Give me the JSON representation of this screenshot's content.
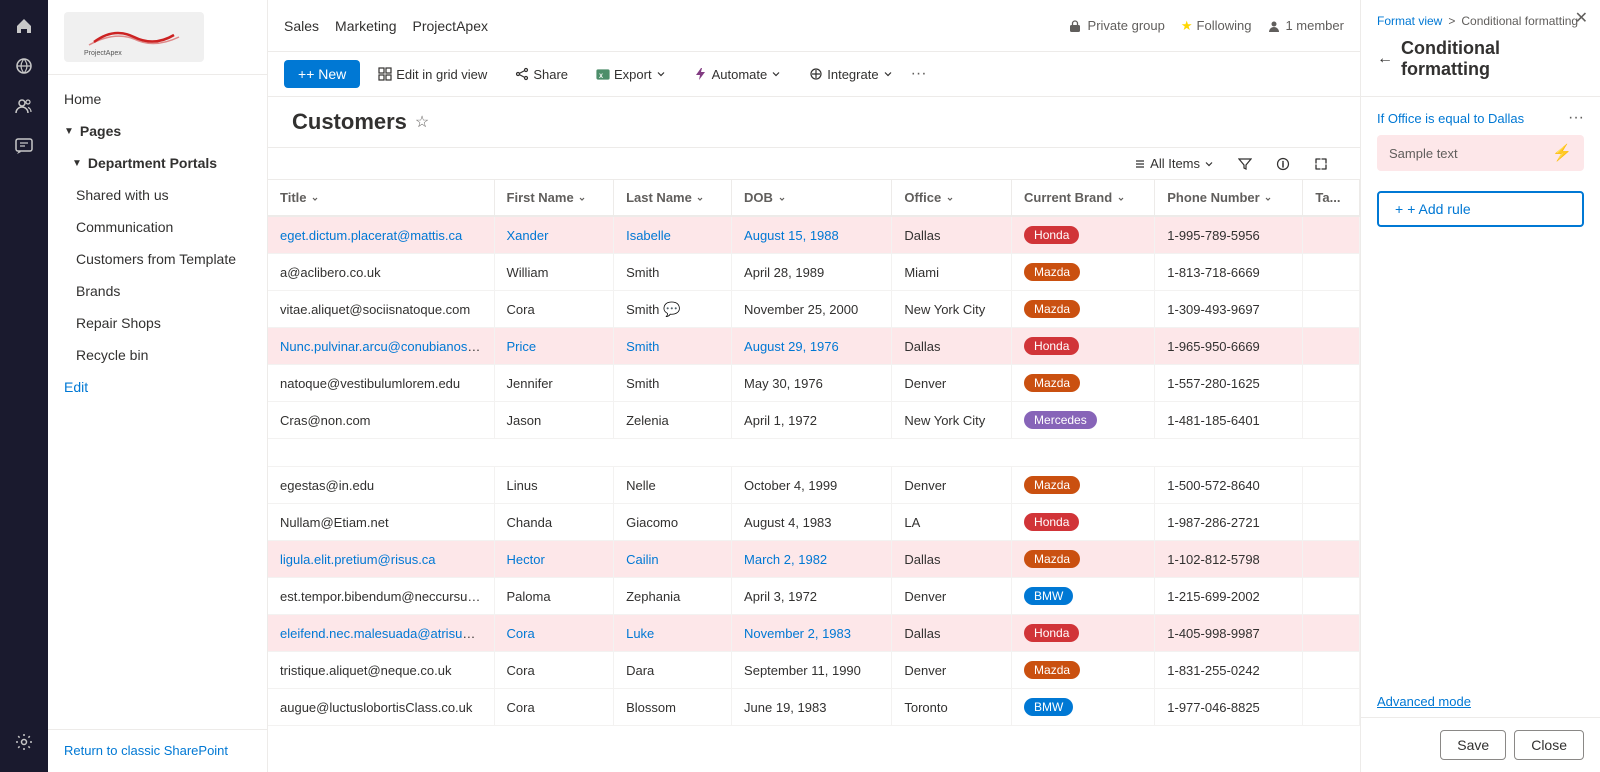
{
  "nav_rail": {
    "icons": [
      "home",
      "globe",
      "people",
      "chat",
      "settings"
    ]
  },
  "sidebar": {
    "home_label": "Home",
    "pages_section_label": "Pages",
    "dept_portals_label": "Department Portals",
    "items": [
      {
        "label": "Shared with us",
        "indent": true
      },
      {
        "label": "Communication",
        "indent": true
      },
      {
        "label": "Customers from Template",
        "indent": true
      },
      {
        "label": "Brands",
        "indent": true
      },
      {
        "label": "Repair Shops",
        "indent": true
      },
      {
        "label": "Recycle bin",
        "indent": true
      }
    ],
    "edit_label": "Edit",
    "footer_link": "Return to classic SharePoint"
  },
  "topbar": {
    "nav_items": [
      "Sales",
      "Marketing",
      "ProjectApex"
    ],
    "group_label": "Private group",
    "following_label": "Following",
    "member_label": "1 member"
  },
  "toolbar": {
    "new_label": "+ New",
    "edit_grid_label": "Edit in grid view",
    "share_label": "Share",
    "export_label": "Export",
    "automate_label": "Automate",
    "integrate_label": "Integrate"
  },
  "page_header": {
    "title": "Customers"
  },
  "view_bar": {
    "all_items_label": "All Items"
  },
  "table": {
    "columns": [
      "Title",
      "First Name",
      "Last Name",
      "DOB",
      "Office",
      "Current Brand",
      "Phone Number",
      "Ta..."
    ],
    "rows": [
      {
        "title": "eget.dictum.placerat@mattis.ca",
        "first_name": "Xander",
        "last_name": "Isabelle",
        "dob": "August 15, 1988",
        "office": "Dallas",
        "brand": "Honda",
        "brand_class": "brand-honda",
        "phone": "1-995-789-5956",
        "highlighted": true
      },
      {
        "title": "a@aclibero.co.uk",
        "first_name": "William",
        "last_name": "Smith",
        "dob": "April 28, 1989",
        "office": "Miami",
        "brand": "Mazda",
        "brand_class": "brand-mazda",
        "phone": "1-813-718-6669",
        "highlighted": false
      },
      {
        "title": "vitae.aliquet@sociisnatoque.com",
        "first_name": "Cora",
        "last_name": "Smith",
        "dob": "November 25, 2000",
        "office": "New York City",
        "brand": "Mazda",
        "brand_class": "brand-mazda",
        "phone": "1-309-493-9697",
        "highlighted": false,
        "has_chat": true
      },
      {
        "title": "Nunc.pulvinar.arcu@conubianostraper.edu",
        "first_name": "Price",
        "last_name": "Smith",
        "dob": "August 29, 1976",
        "office": "Dallas",
        "brand": "Honda",
        "brand_class": "brand-honda",
        "phone": "1-965-950-6669",
        "highlighted": true
      },
      {
        "title": "natoque@vestibulumlorem.edu",
        "first_name": "Jennifer",
        "last_name": "Smith",
        "dob": "May 30, 1976",
        "office": "Denver",
        "brand": "Mazda",
        "brand_class": "brand-mazda",
        "phone": "1-557-280-1625",
        "highlighted": false
      },
      {
        "title": "Cras@non.com",
        "first_name": "Jason",
        "last_name": "Zelenia",
        "dob": "April 1, 1972",
        "office": "New York City",
        "brand": "Mercedes",
        "brand_class": "brand-mercedes",
        "phone": "1-481-185-6401",
        "highlighted": false
      },
      {
        "title": "",
        "first_name": "",
        "last_name": "",
        "dob": "",
        "office": "",
        "brand": "",
        "brand_class": "",
        "phone": "",
        "highlighted": false,
        "empty": true
      },
      {
        "title": "egestas@in.edu",
        "first_name": "Linus",
        "last_name": "Nelle",
        "dob": "October 4, 1999",
        "office": "Denver",
        "brand": "Mazda",
        "brand_class": "brand-mazda",
        "phone": "1-500-572-8640",
        "highlighted": false
      },
      {
        "title": "Nullam@Etiam.net",
        "first_name": "Chanda",
        "last_name": "Giacomo",
        "dob": "August 4, 1983",
        "office": "LA",
        "brand": "Honda",
        "brand_class": "brand-honda",
        "phone": "1-987-286-2721",
        "highlighted": false
      },
      {
        "title": "ligula.elit.pretium@risus.ca",
        "first_name": "Hector",
        "last_name": "Cailin",
        "dob": "March 2, 1982",
        "office": "Dallas",
        "brand": "Mazda",
        "brand_class": "brand-mazda",
        "phone": "1-102-812-5798",
        "highlighted": true
      },
      {
        "title": "est.tempor.bibendum@neccursusa.com",
        "first_name": "Paloma",
        "last_name": "Zephania",
        "dob": "April 3, 1972",
        "office": "Denver",
        "brand": "BMW",
        "brand_class": "brand-bmw",
        "phone": "1-215-699-2002",
        "highlighted": false
      },
      {
        "title": "eleifend.nec.malesuada@atrisus.ca",
        "first_name": "Cora",
        "last_name": "Luke",
        "dob": "November 2, 1983",
        "office": "Dallas",
        "brand": "Honda",
        "brand_class": "brand-honda",
        "phone": "1-405-998-9987",
        "highlighted": true
      },
      {
        "title": "tristique.aliquet@neque.co.uk",
        "first_name": "Cora",
        "last_name": "Dara",
        "dob": "September 11, 1990",
        "office": "Denver",
        "brand": "Mazda",
        "brand_class": "brand-mazda",
        "phone": "1-831-255-0242",
        "highlighted": false
      },
      {
        "title": "augue@luctuslobortisClass.co.uk",
        "first_name": "Cora",
        "last_name": "Blossom",
        "dob": "June 19, 1983",
        "office": "Toronto",
        "brand": "BMW",
        "brand_class": "brand-bmw",
        "phone": "1-977-046-8825",
        "highlighted": false
      }
    ]
  },
  "right_panel": {
    "breadcrumb_format": "Format view",
    "breadcrumb_sep": ">",
    "breadcrumb_current": "Conditional formatting",
    "title": "Conditional formatting",
    "rule_condition": "If Office is equal to Dallas",
    "rule_sample_text": "Sample text",
    "add_rule_label": "+ Add rule",
    "advanced_mode_label": "Advanced mode",
    "save_label": "Save",
    "close_label": "Close"
  }
}
